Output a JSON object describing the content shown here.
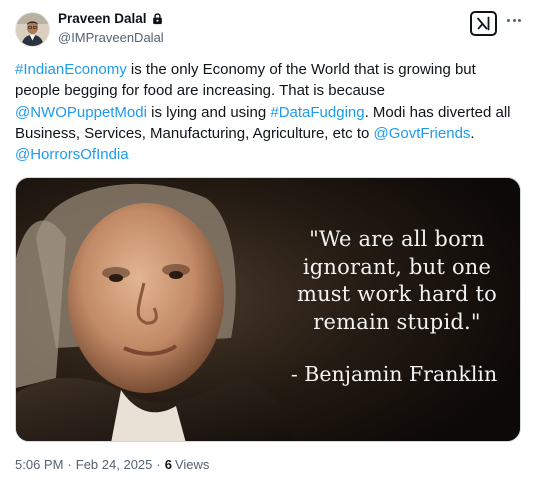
{
  "author": {
    "display_name": "Praveen Dalal",
    "handle": "@IMPraveenDalal",
    "avatar_icon": "person-avatar-icon",
    "protected_icon": "lock-icon"
  },
  "header_actions": {
    "grok_icon": "grok-icon",
    "more_icon": "more-dots-icon"
  },
  "tweet": {
    "segments": [
      {
        "text": "#IndianEconomy",
        "type": "hashtag"
      },
      {
        "text": " is the only Economy of the World that is growing but people begging for food are increasing. That is because ",
        "type": "text"
      },
      {
        "text": "@NWOPuppetModi",
        "type": "mention"
      },
      {
        "text": " is lying and using ",
        "type": "text"
      },
      {
        "text": "#DataFudging",
        "type": "hashtag"
      },
      {
        "text": ". Modi has diverted all Business, Services, Manufacturing, Agriculture, etc to ",
        "type": "text"
      },
      {
        "text": "@GovtFriends",
        "type": "mention"
      },
      {
        "text": ". ",
        "type": "text"
      },
      {
        "text": "@HorrorsOfIndia",
        "type": "mention"
      }
    ]
  },
  "media": {
    "quote_lines": [
      "\"We are all born",
      "ignorant, but one",
      "must work hard to",
      "remain stupid.\""
    ],
    "author_line": "- Benjamin Franklin"
  },
  "meta": {
    "time": "5:06 PM",
    "date": "Feb 24, 2025",
    "separator": "·",
    "views_count": "6",
    "views_label": "Views"
  },
  "colors": {
    "link": "#1d9bf0",
    "text": "#0f1419",
    "secondary": "#536471"
  }
}
